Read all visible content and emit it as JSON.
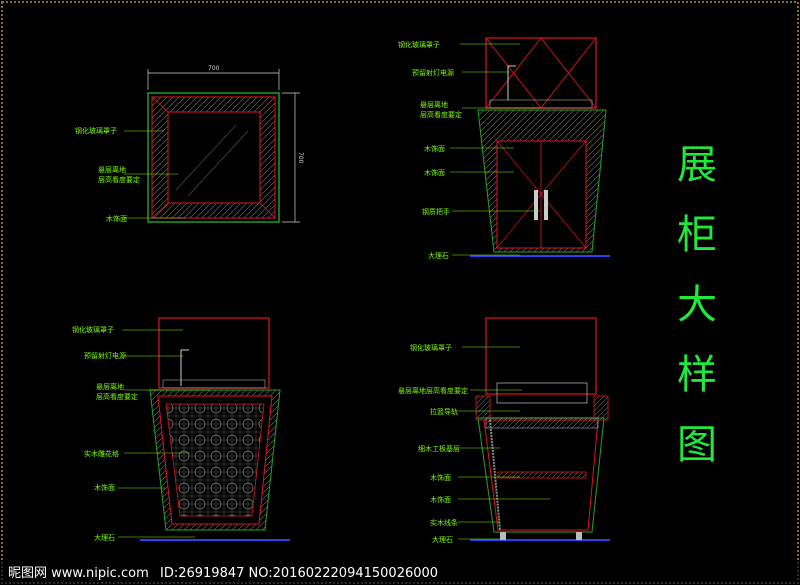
{
  "title": {
    "chars": [
      "展",
      "柜",
      "大",
      "样",
      "图"
    ]
  },
  "views": {
    "plan": {
      "dim_top": "700",
      "dim_right": "700",
      "labels": [
        "钢化玻璃罩子",
        "悬层离地",
        "层高看度要定",
        "木饰面"
      ]
    },
    "front": {
      "labels": [
        "钢化玻璃罩子",
        "预留射灯电源",
        "悬层离地",
        "层高看度要定",
        "木饰面",
        "木饰面",
        "钢质把手",
        "大理石"
      ]
    },
    "side": {
      "labels": [
        "钢化玻璃罩子",
        "预留射灯电源",
        "悬层离地",
        "层高看度要定",
        "实木雕花格",
        "木饰面",
        "大理石"
      ]
    },
    "section": {
      "labels": [
        "钢化玻璃罩子",
        "悬层离地层高看度要定",
        "拉篮导轨",
        "细木工板基层",
        "木饰面",
        "木饰面",
        "实木线条",
        "大理石"
      ]
    }
  },
  "watermark": {
    "site": "昵图网 www.nipic.com",
    "id_text": "ID:26919847 NO:20160222094150026000"
  },
  "colors": {
    "background": "#000000",
    "label_green": "#7cfc00",
    "title_green": "#22e83a",
    "outline_red": "#e0141e",
    "frame_green": "#1fa81f",
    "hatch_gray": "#8a8a8a",
    "dim_gray": "#cfcfcf",
    "floor_blue": "#2d3ff0",
    "border_dots": "#8b6a3a"
  }
}
